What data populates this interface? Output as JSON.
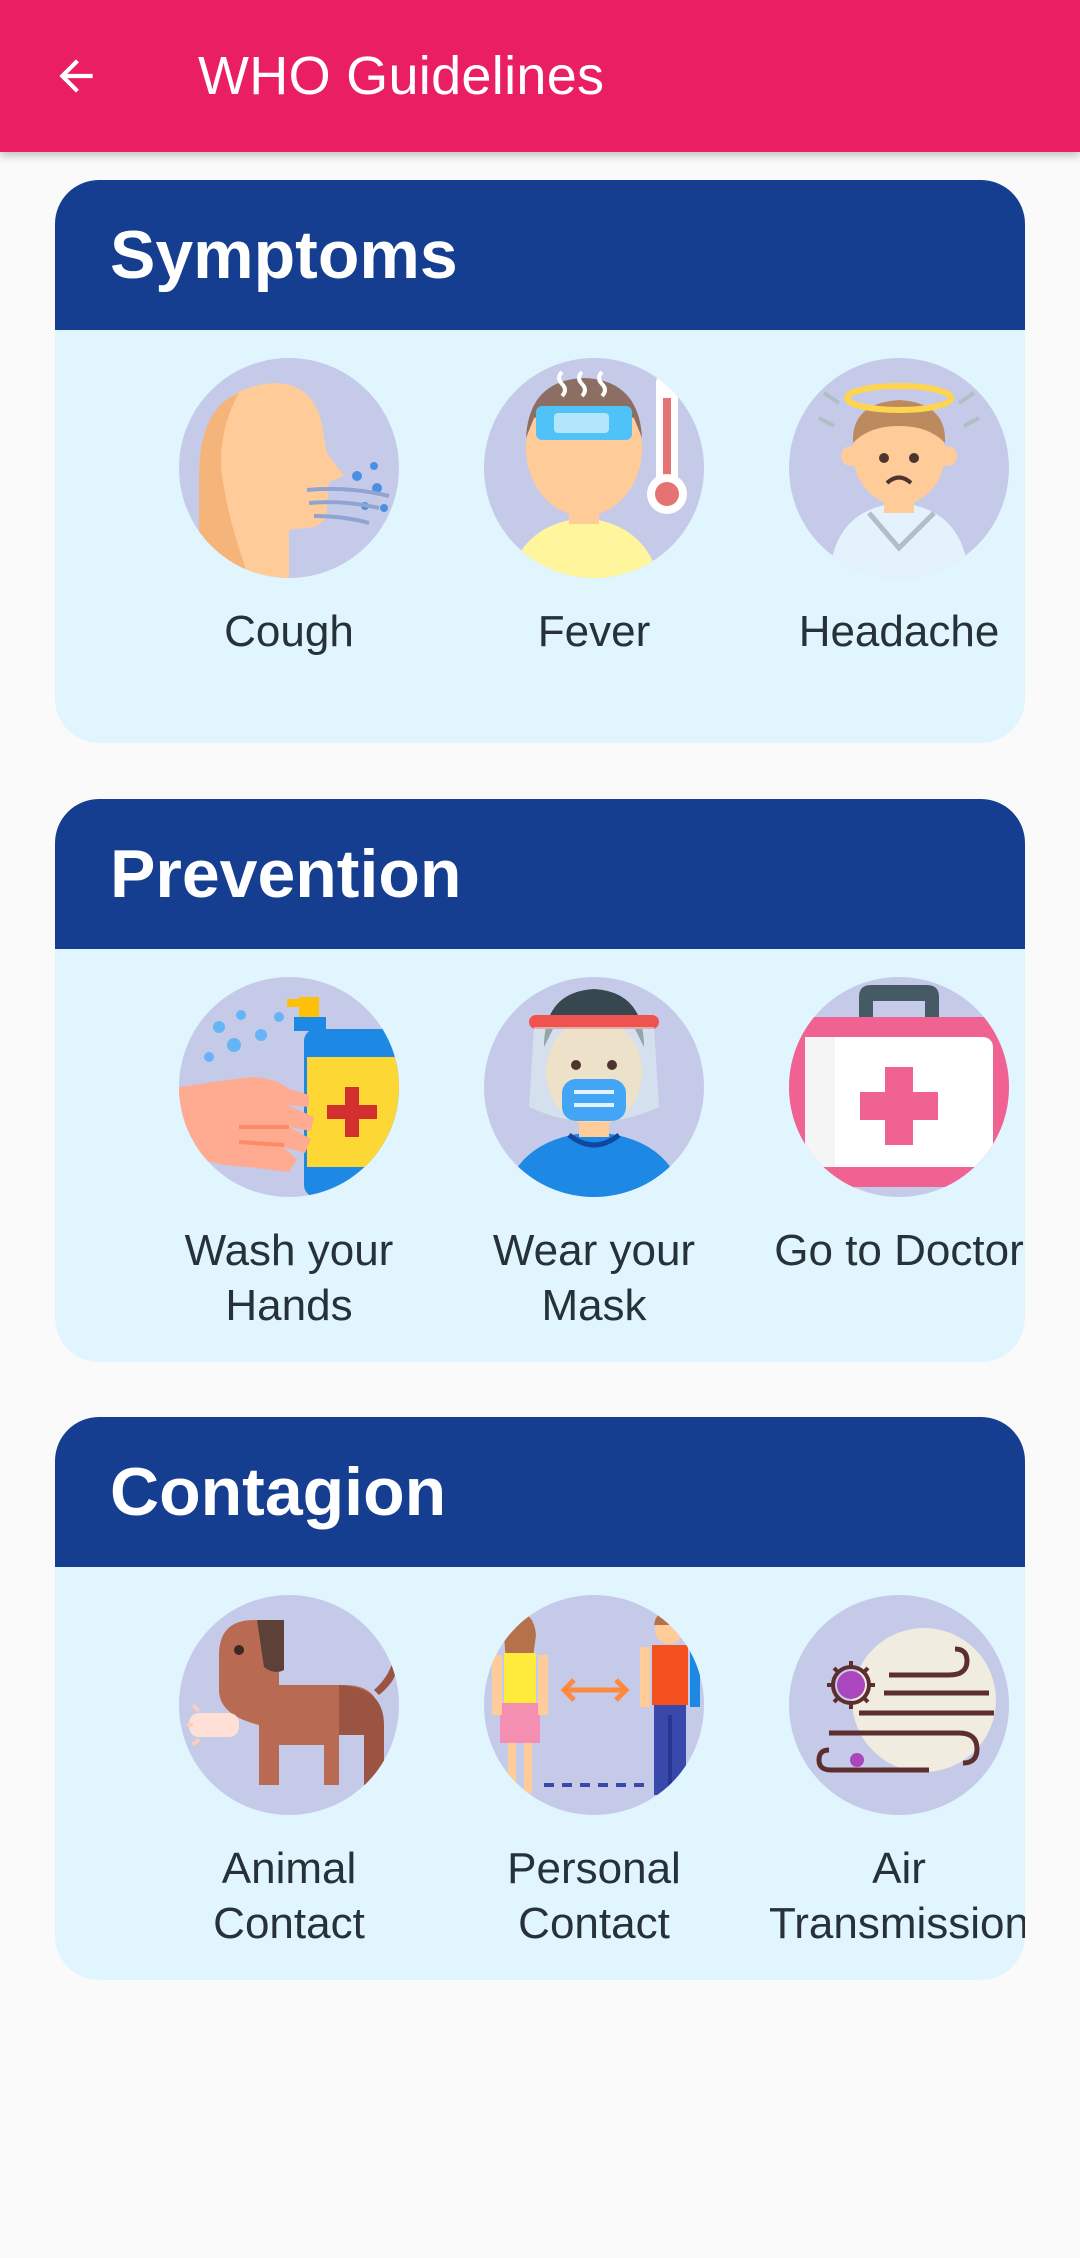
{
  "appbar": {
    "title": "WHO Guidelines",
    "color": "#e91e63",
    "back_icon": "arrow-left-icon"
  },
  "sections": [
    {
      "title": "Symptoms",
      "items": [
        {
          "label": "Cough",
          "icon": "cough-icon"
        },
        {
          "label": "Fever",
          "icon": "fever-thermometer-icon"
        },
        {
          "label": "Headache",
          "icon": "headache-icon"
        }
      ]
    },
    {
      "title": "Prevention",
      "items": [
        {
          "label": "Wash your\nHands",
          "icon": "hand-wash-sanitizer-icon"
        },
        {
          "label": "Wear your\nMask",
          "icon": "face-mask-shield-icon"
        },
        {
          "label": "Go to Doctor",
          "icon": "first-aid-kit-icon"
        }
      ]
    },
    {
      "title": "Contagion",
      "items": [
        {
          "label": "Animal\nContact",
          "icon": "dog-icon"
        },
        {
          "label": "Personal\nContact",
          "icon": "two-people-distance-icon"
        },
        {
          "label": "Air\nTransmission",
          "icon": "virus-wind-icon"
        }
      ]
    }
  ],
  "colors": {
    "header_blue": "#153e90",
    "card_background": "#e1f5fe",
    "icon_circle": "#c5cae9",
    "page_background": "#fafafa"
  }
}
